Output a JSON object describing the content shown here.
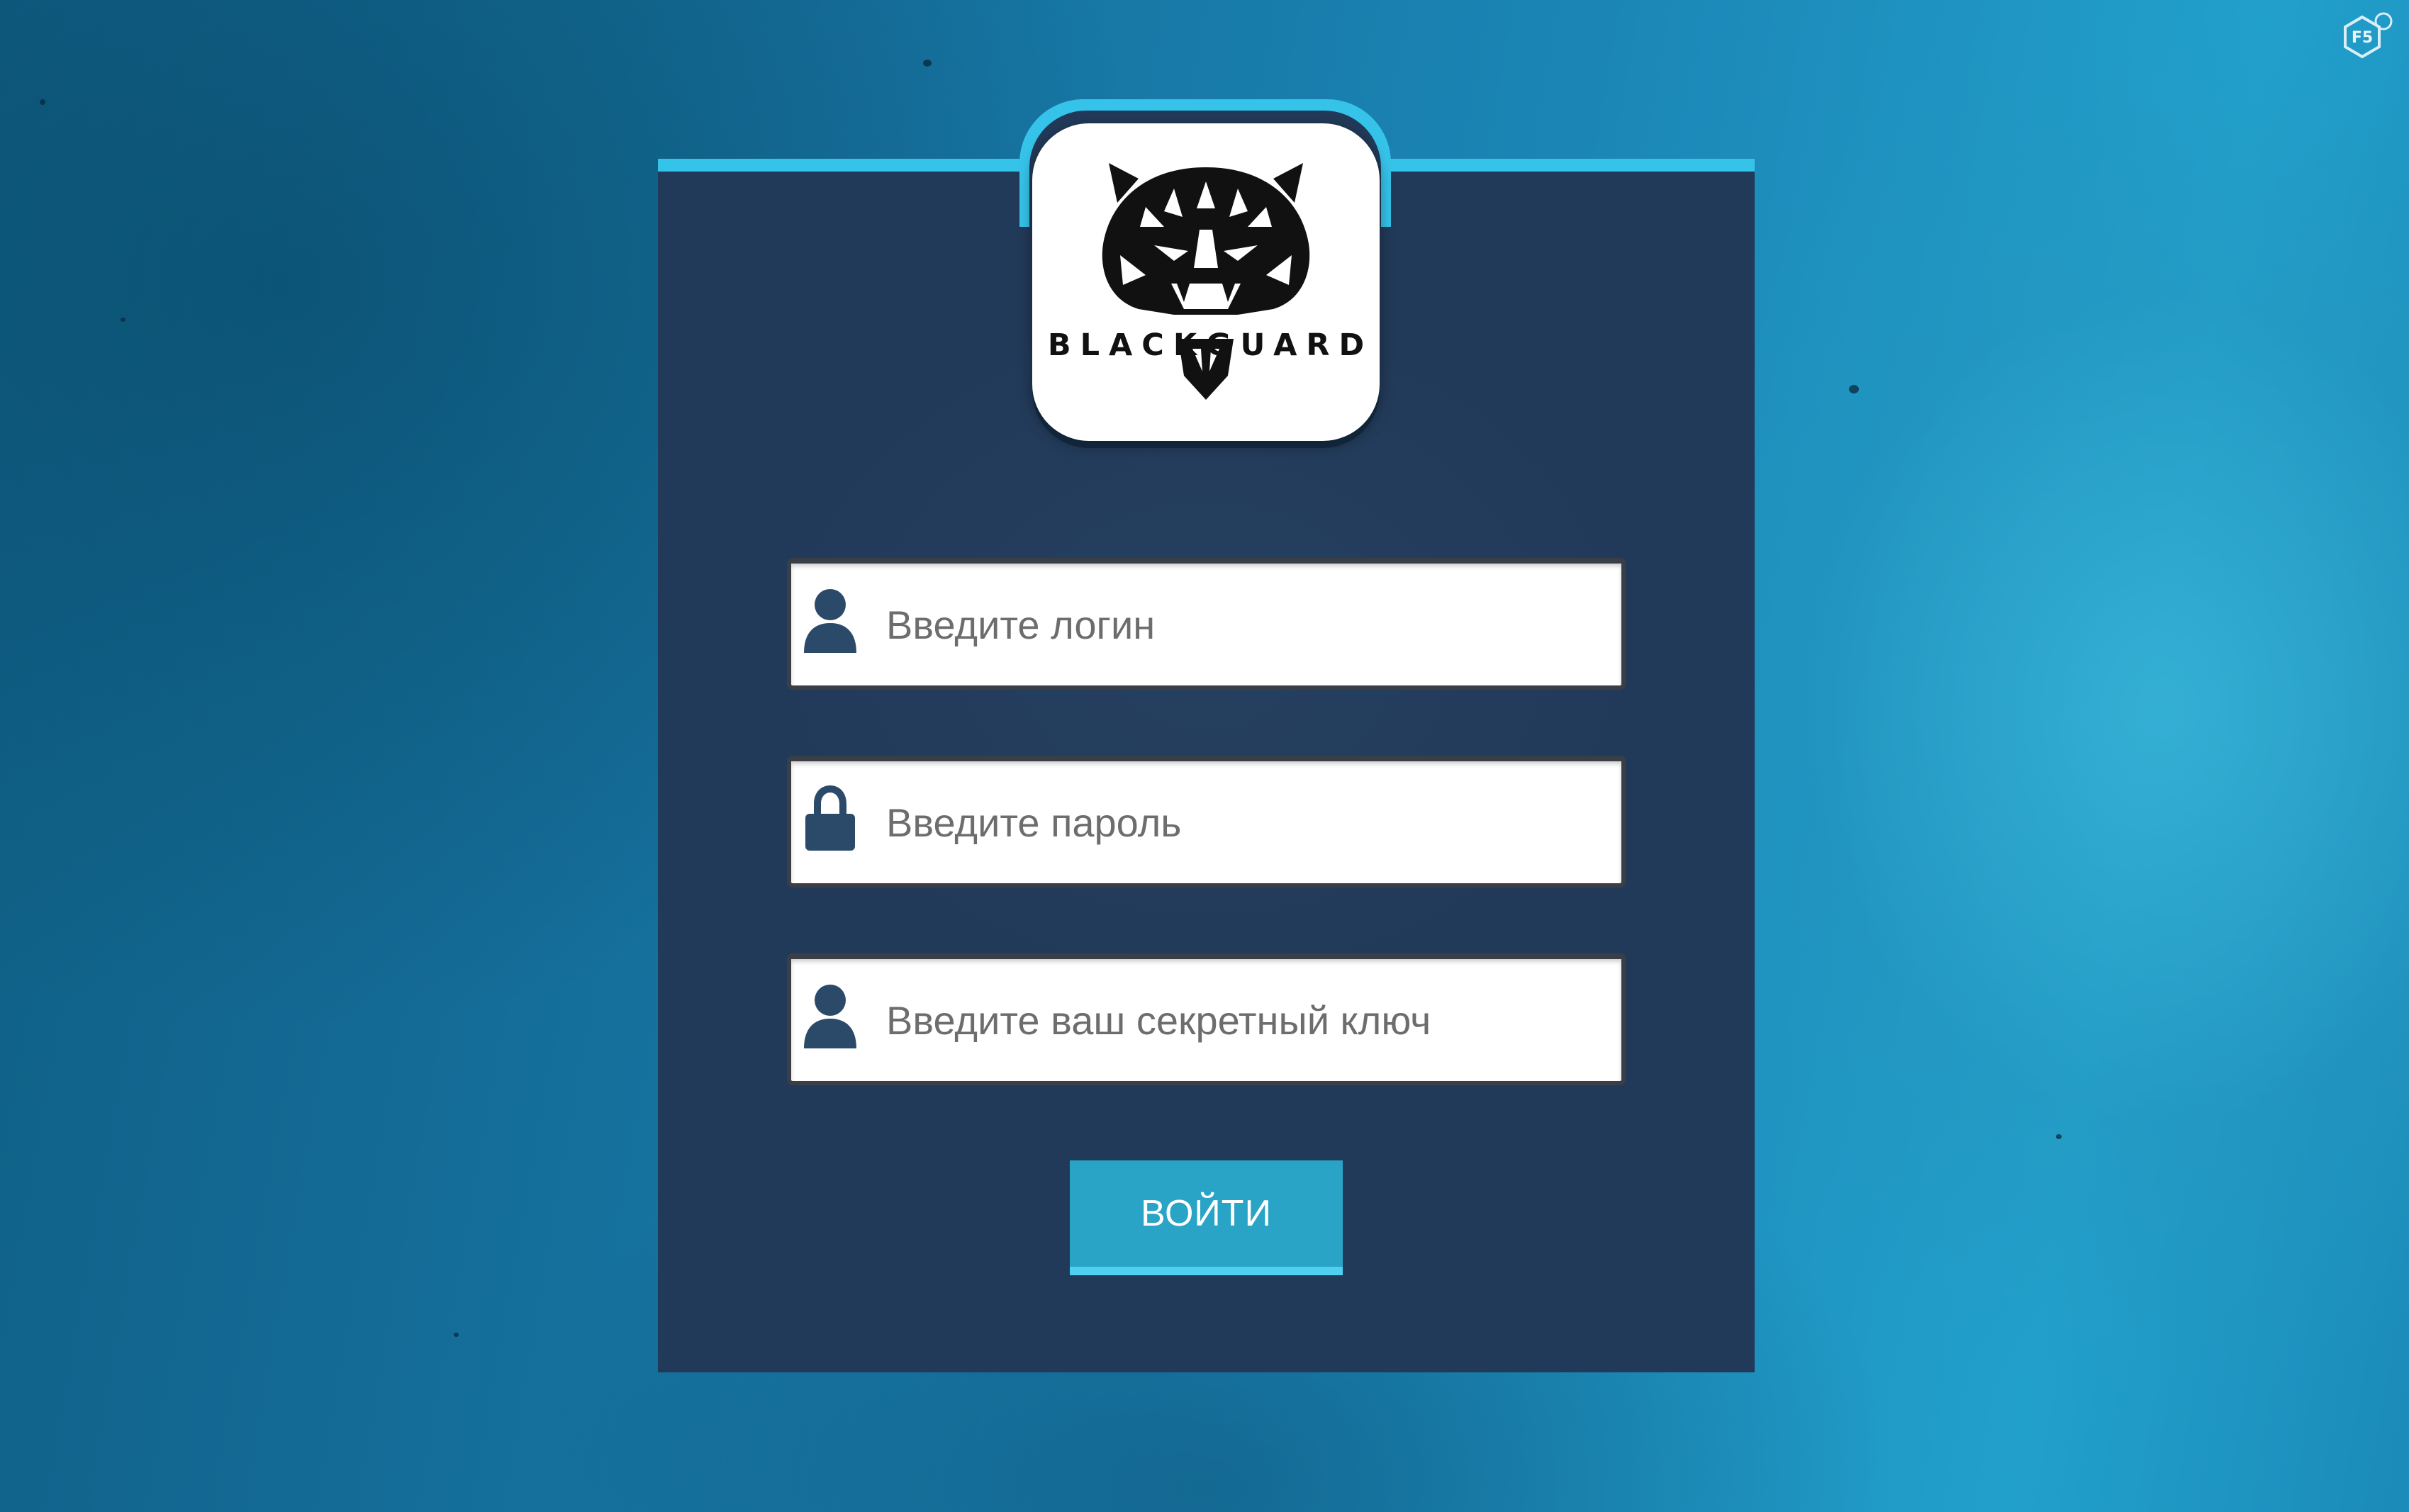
{
  "brand": {
    "name": "BLACKGUARD",
    "logo_icon": "tiger-head-icon"
  },
  "corner_badge": {
    "label": "F5",
    "icon": "hexagon-badge-icon"
  },
  "form": {
    "login": {
      "placeholder": "Введите логин",
      "value": "",
      "icon": "user-icon"
    },
    "password": {
      "placeholder": "Введите пароль",
      "value": "",
      "icon": "lock-icon"
    },
    "secret_key": {
      "placeholder": "Введите ваш секретный ключ",
      "value": "",
      "icon": "user-icon"
    },
    "submit_label": "ВОЙТИ"
  },
  "colors": {
    "accent": "#36c3ea",
    "card_background": "#223a59",
    "button": "#2aa4c6",
    "icon": "#2b4a6a"
  }
}
